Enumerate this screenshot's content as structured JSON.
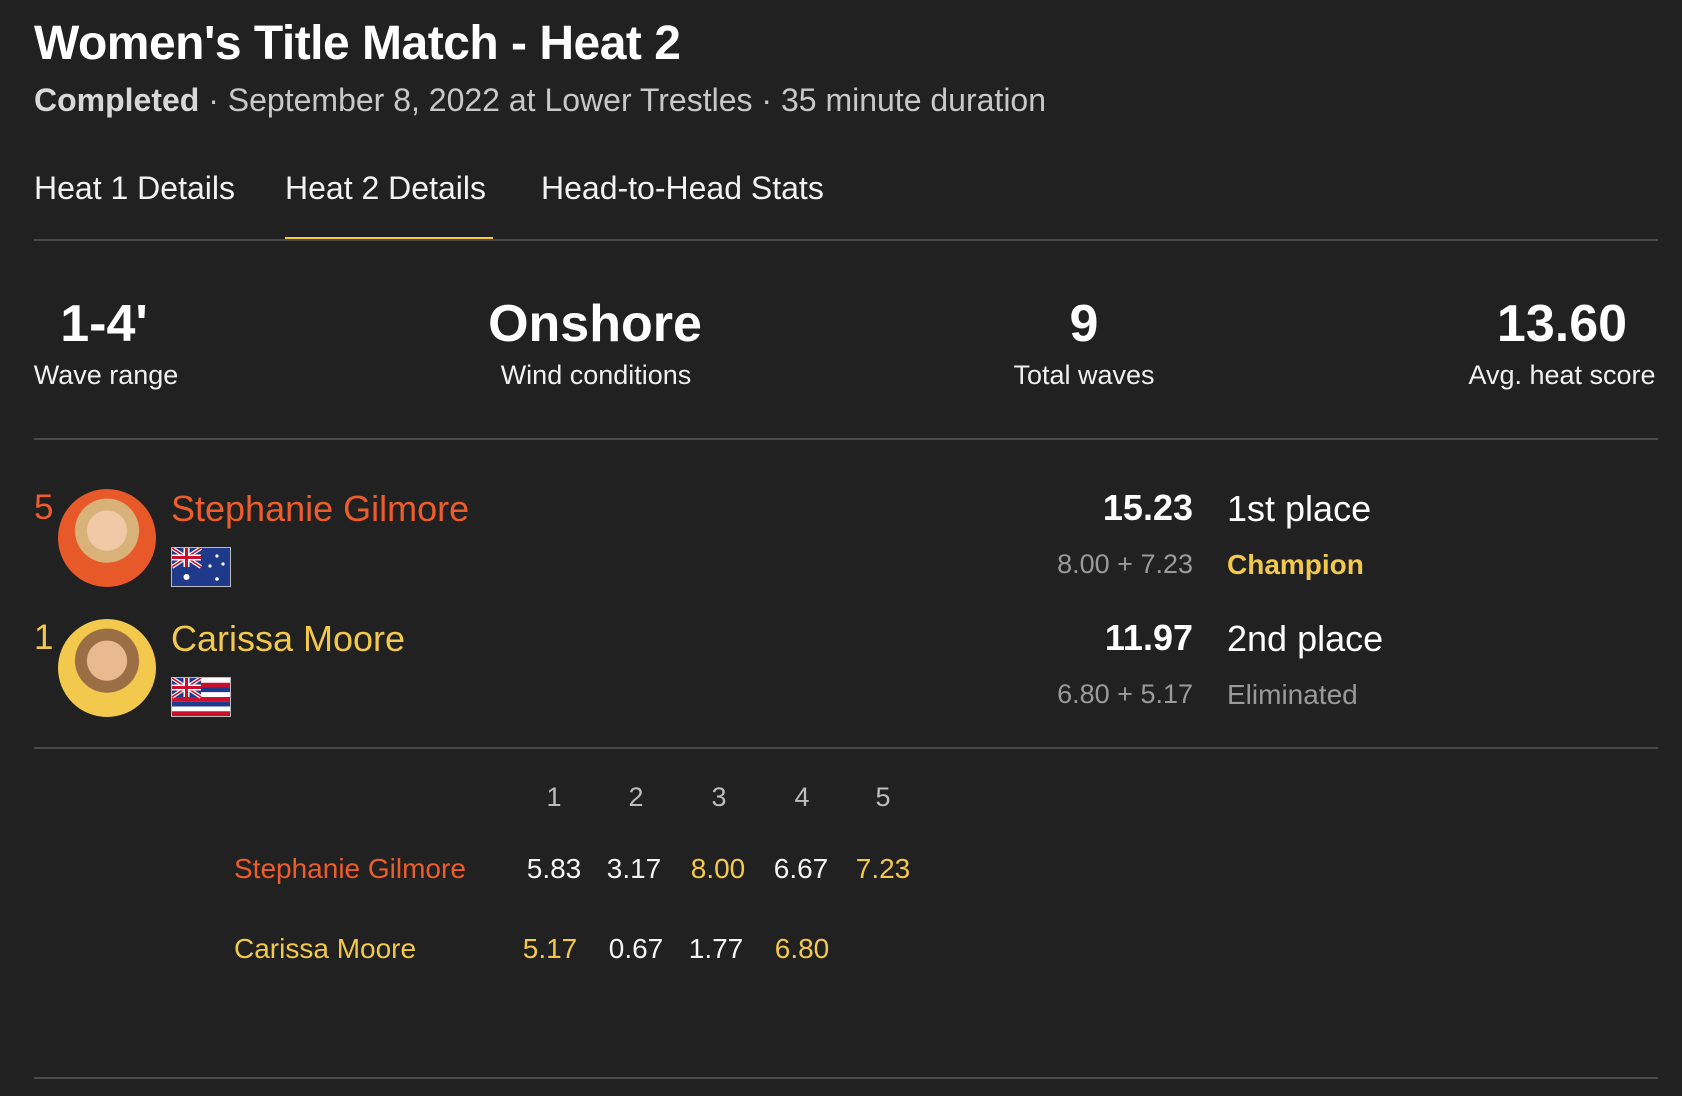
{
  "header": {
    "title": "Women's Title Match - Heat 2",
    "status": "Completed",
    "details": " · September 8, 2022 at Lower Trestles · 35 minute duration"
  },
  "tabs": [
    {
      "label": "Heat 1 Details",
      "active": false
    },
    {
      "label": "Heat 2 Details",
      "active": true
    },
    {
      "label": "Head-to-Head Stats",
      "active": false
    }
  ],
  "stats": {
    "wave_range": {
      "value": "1-4'",
      "label": "Wave range"
    },
    "wind": {
      "value": "Onshore",
      "label": "Wind conditions"
    },
    "total_waves": {
      "value": "9",
      "label": "Total waves"
    },
    "avg_score": {
      "value": "13.60",
      "label": "Avg. heat score"
    }
  },
  "athletes": [
    {
      "seed": "5",
      "name": "Stephanie Gilmore",
      "flag": "australia-flag",
      "total": "15.23",
      "breakdown": "8.00 + 7.23",
      "place": "1st place",
      "result": "Champion",
      "color": "#ed5d2b"
    },
    {
      "seed": "1",
      "name": "Carissa Moore",
      "flag": "hawaii-flag",
      "total": "11.97",
      "breakdown": "6.80 + 5.17",
      "place": "2nd place",
      "result": "Eliminated",
      "color": "#f2c94c"
    }
  ],
  "wave_table": {
    "columns": [
      "1",
      "2",
      "3",
      "4",
      "5"
    ],
    "rows": [
      {
        "name": "Stephanie Gilmore",
        "scores": [
          "5.83",
          "3.17",
          "8.00",
          "6.67",
          "7.23"
        ],
        "counted": [
          false,
          false,
          true,
          false,
          true
        ]
      },
      {
        "name": "Carissa Moore",
        "scores": [
          "5.17",
          "0.67",
          "1.77",
          "6.80"
        ],
        "counted": [
          true,
          false,
          false,
          true
        ]
      }
    ]
  },
  "colors": {
    "accent": "#f2c94c",
    "athlete1": "#ed5d2b",
    "athlete2": "#f2c94c",
    "background": "#212121"
  }
}
